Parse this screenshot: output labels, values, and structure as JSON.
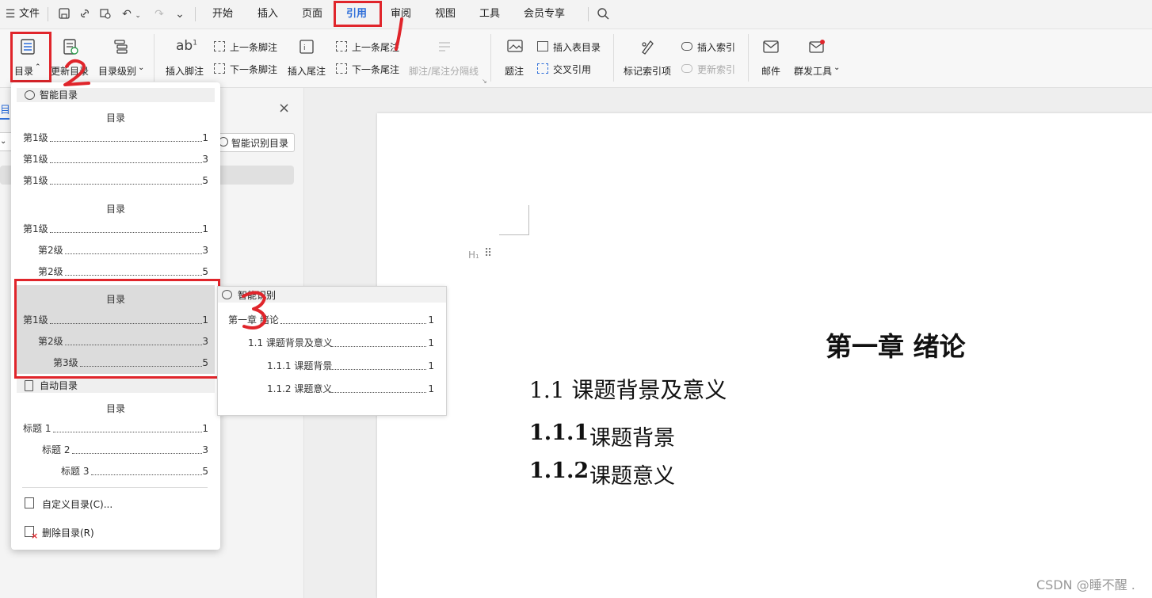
{
  "menubar": {
    "file_label": "文件",
    "tabs": [
      "开始",
      "插入",
      "页面",
      "引用",
      "审阅",
      "视图",
      "工具",
      "会员专享"
    ],
    "active_tab": "引用"
  },
  "ribbon": {
    "toc": "目录",
    "update_toc": "更新目录",
    "toc_level": "目录级别",
    "insert_footnote": "插入脚注",
    "prev_footnote": "上一条脚注",
    "next_footnote": "下一条脚注",
    "insert_endnote": "插入尾注",
    "prev_endnote": "上一条尾注",
    "next_endnote": "下一条尾注",
    "note_separator": "脚注/尾注分隔线",
    "caption": "题注",
    "insert_table_of_figures": "插入表目录",
    "cross_reference": "交叉引用",
    "mark_index_entry": "标记索引项",
    "insert_index": "插入索引",
    "update_index": "更新索引",
    "mail": "邮件",
    "mass_send": "群发工具"
  },
  "annotations": {
    "one": "1",
    "two": "2",
    "three": "3"
  },
  "left_panel": {
    "title_partial": "目",
    "smart_toc_button": "智能识别目录"
  },
  "dropdown": {
    "smart_toc_header": "智能目录",
    "toc_title": "目录",
    "style1": [
      {
        "label": "第1级",
        "page": "1"
      },
      {
        "label": "第1级",
        "page": "3"
      },
      {
        "label": "第1级",
        "page": "5"
      }
    ],
    "style2": [
      {
        "label": "第1级",
        "page": "1"
      },
      {
        "label": "第2级",
        "page": "3"
      },
      {
        "label": "第2级",
        "page": "5"
      }
    ],
    "style3": [
      {
        "label": "第1级",
        "page": "1"
      },
      {
        "label": "第2级",
        "page": "3"
      },
      {
        "label": "第3级",
        "page": "5"
      }
    ],
    "auto_toc_header": "自动目录",
    "style4": [
      {
        "label": "标题 1",
        "page": "1"
      },
      {
        "label": "标题 2",
        "page": "3"
      },
      {
        "label": "标题 3",
        "page": "5"
      }
    ],
    "custom_toc": "自定义目录(C)...",
    "delete_toc": "删除目录(R)"
  },
  "preview": {
    "header": "智能识别",
    "lines": [
      {
        "label": "第一章 绪论",
        "page": "1"
      },
      {
        "label": "1.1 课题背景及意义",
        "page": "1"
      },
      {
        "label": "1.1.1 课题背景",
        "page": "1"
      },
      {
        "label": "1.1.2 课题意义",
        "page": "1"
      }
    ]
  },
  "document": {
    "heading_marker": "H₁",
    "chapter": "第一章  绪论",
    "h2": "1.1  课题背景及意义",
    "h3a_num": "1.1.1",
    "h3a_text": "课题背景",
    "h3b_num": "1.1.2",
    "h3b_text": "课题意义"
  },
  "watermark": "CSDN @睡不醒 .",
  "colors": {
    "accent": "#2f6fd9",
    "annotation": "#e0252b"
  }
}
